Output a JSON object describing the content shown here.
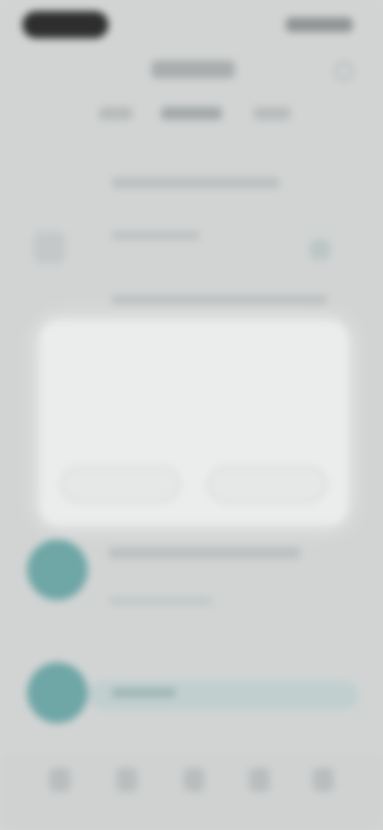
{
  "colors": {
    "background": "#d2d4d4",
    "dialog": "#ebedec",
    "accent_teal": "#6fa6a6"
  },
  "header": {
    "back_icon": "chevron-icon",
    "menu_icon": "more-icon"
  },
  "dialog": {
    "title": "",
    "body": "",
    "secondary_button": "",
    "primary_button": ""
  },
  "list": {
    "items": [
      {
        "avatar_icon": "teal-avatar"
      },
      {
        "avatar_icon": "teal-avatar"
      }
    ]
  },
  "nav": {
    "icons": [
      "home-icon",
      "search-icon",
      "add-icon",
      "chat-icon",
      "profile-icon"
    ]
  }
}
